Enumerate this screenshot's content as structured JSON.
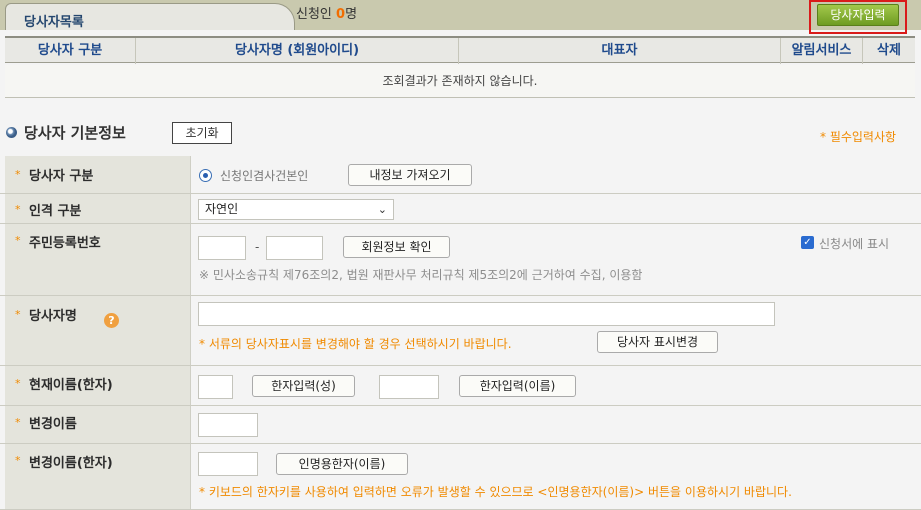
{
  "list": {
    "tab_label": "당사자목록",
    "applicant_prefix": "신청인 ",
    "applicant_count": "0",
    "applicant_suffix": "명",
    "add_button": "당사자입력",
    "columns": [
      "당사자 구분",
      "당사자명 (회원아이디)",
      "대표자",
      "알림서비스",
      "삭제"
    ],
    "empty_message": "조회결과가 존재하지 않습니다."
  },
  "section": {
    "title": "당사자 기본정보",
    "reset_button": "초기화",
    "required_note": "* 필수입력사항"
  },
  "form": {
    "party_type": {
      "label": "당사자 구분",
      "radio_label": "신청인겸사건본인",
      "load_button": "내정보 가져오기"
    },
    "person_type": {
      "label": "인격 구분",
      "selected": "자연인"
    },
    "resident_no": {
      "label": "주민등록번호",
      "separator": "-",
      "verify_button": "회원정보 확인",
      "show_in_application": "신청서에 표시",
      "notice": "※ 민사소송규칙 제76조의2, 법원 재판사무 처리규칙 제5조의2에 근거하여 수집, 이용함"
    },
    "party_name": {
      "label": "당사자명",
      "change_hint": "* 서류의 당사자표시를 변경해야 할 경우 선택하시기 바랍니다.",
      "change_button": "당사자 표시변경"
    },
    "current_name_hanja": {
      "label": "현재이름(한자)",
      "surname_button": "한자입력(성)",
      "given_button": "한자입력(이름)"
    },
    "changed_name": {
      "label": "변경이름"
    },
    "changed_name_hanja": {
      "label": "변경이름(한자)",
      "button": "인명용한자(이름)",
      "hint": "* 키보드의 한자키를 사용하여 입력하면 오류가 발생할 수 있으므로 <인명용한자(이름)> 버튼을 이용하시기 바랍니다."
    }
  },
  "colors": {
    "accent_orange": "#f08a00",
    "header_blue": "#1f4a8c",
    "add_button_green": "#8ab437",
    "highlight_red": "#d91a1a"
  }
}
